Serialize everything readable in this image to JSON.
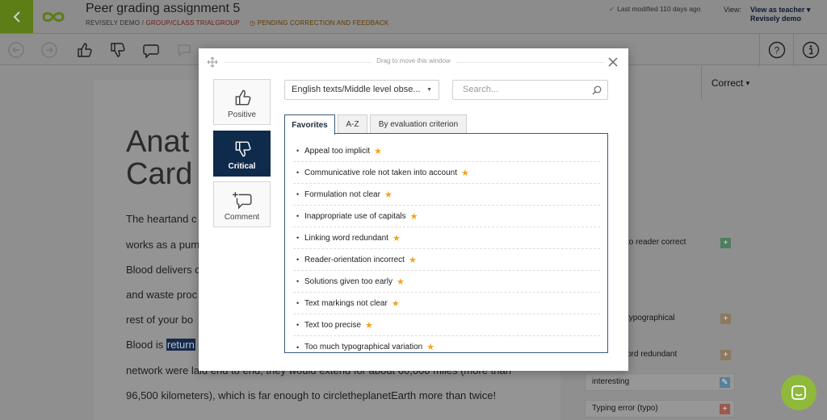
{
  "header": {
    "title": "Peer grading assignment 5",
    "breadcrumb_org": "REVISELY DEMO /",
    "breadcrumb_group": "GROUP/CLASS TRIALGROUP",
    "status": "PENDING CORRECTION AND FEEDBACK",
    "last_modified": "Last modified 110 days ago",
    "view_label": "View:",
    "view_role": "View as teacher",
    "view_user": "Revisely demo"
  },
  "toolbar": {
    "correct_label": "Correct"
  },
  "document": {
    "heading_lines": [
      "Anat",
      "Card"
    ],
    "lines": [
      "The heartand c",
      "works as a pum",
      "Blood delivers c",
      "and waste proc",
      "rest of your bo",
      "Blood is ",
      "network were laid end to end, they would extend for about 60,000 miles (more than",
      "96,500 kilometers), which is far enough to circletheplanetEarth more than twice!"
    ],
    "highlight": "return"
  },
  "side_comments": [
    {
      "text": "to reader correct"
    },
    {
      "text": "typographical"
    },
    {
      "text": "ord redundant"
    },
    {
      "text": "interesting"
    },
    {
      "text": "Typing error (typo)"
    }
  ],
  "modal": {
    "drag_hint": "Drag to move this window",
    "types": [
      {
        "label": "Positive",
        "icon": "thumbs-up-icon"
      },
      {
        "label": "Critical",
        "icon": "thumbs-down-icon"
      },
      {
        "label": "Comment",
        "icon": "comment-add-icon"
      }
    ],
    "category_value": "English texts/Middle level obse...",
    "search_placeholder": "Search...",
    "tabs": [
      "Favorites",
      "A-Z",
      "By evaluation criterion"
    ],
    "active_tab": "Favorites",
    "items": [
      "Appeal too implicit",
      "Communicative role not taken into account",
      "Formulation not clear",
      "Inappropriate use of capitals",
      "Linking word redundant",
      "Reader-orientation incorrect",
      "Solutions given too early",
      "Text markings not clear",
      "Text too precise",
      "Too much typographical variation"
    ]
  },
  "colors": {
    "critical_active": "#0f2b4b",
    "favorite_star": "#f4a21a",
    "brand_green": "#8fb93a"
  }
}
